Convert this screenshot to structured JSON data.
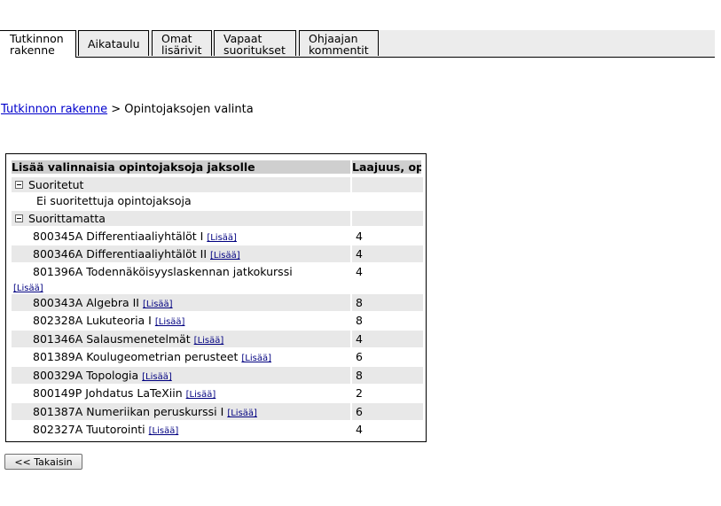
{
  "tabs": [
    {
      "label": "Tutkinnon\nrakenne",
      "active": true
    },
    {
      "label": "Aikataulu",
      "active": false
    },
    {
      "label": "Omat\nlisärivit",
      "active": false
    },
    {
      "label": "Vapaat\nsuoritukset",
      "active": false
    },
    {
      "label": "Ohjaajan\nkommentit",
      "active": false
    }
  ],
  "breadcrumb": {
    "link": "Tutkinnon rakenne",
    "separator": ">",
    "current": "Opintojaksojen valinta"
  },
  "table": {
    "header_title": "Lisää valinnaisia opintojaksoja jaksolle",
    "header_credits": "Laajuus, op",
    "group_done": "Suoritetut",
    "no_done": "Ei suoritettuja opintojaksoja",
    "group_todo": "Suorittamatta",
    "add_label": "[Lisää]",
    "courses": [
      {
        "name": "800345A Differentiaaliyhtälöt I",
        "credits": "4"
      },
      {
        "name": "800346A Differentiaaliyhtälöt II",
        "credits": "4"
      },
      {
        "name": "801396A Todennäköisyyslaskennan jatkokurssi",
        "credits": "4"
      },
      {
        "name": "800343A Algebra II",
        "credits": "8"
      },
      {
        "name": "802328A Lukuteoria I",
        "credits": "8"
      },
      {
        "name": "801346A Salausmenetelmät",
        "credits": "4"
      },
      {
        "name": "801389A Koulugeometrian perusteet",
        "credits": "6"
      },
      {
        "name": "800329A Topologia",
        "credits": "8"
      },
      {
        "name": "800149P Johdatus LaTeXiin",
        "credits": "2"
      },
      {
        "name": "801387A Numeriikan peruskurssi I",
        "credits": "6"
      },
      {
        "name": "802327A Tuutorointi",
        "credits": "4"
      }
    ]
  },
  "back_button": "<< Takaisin"
}
